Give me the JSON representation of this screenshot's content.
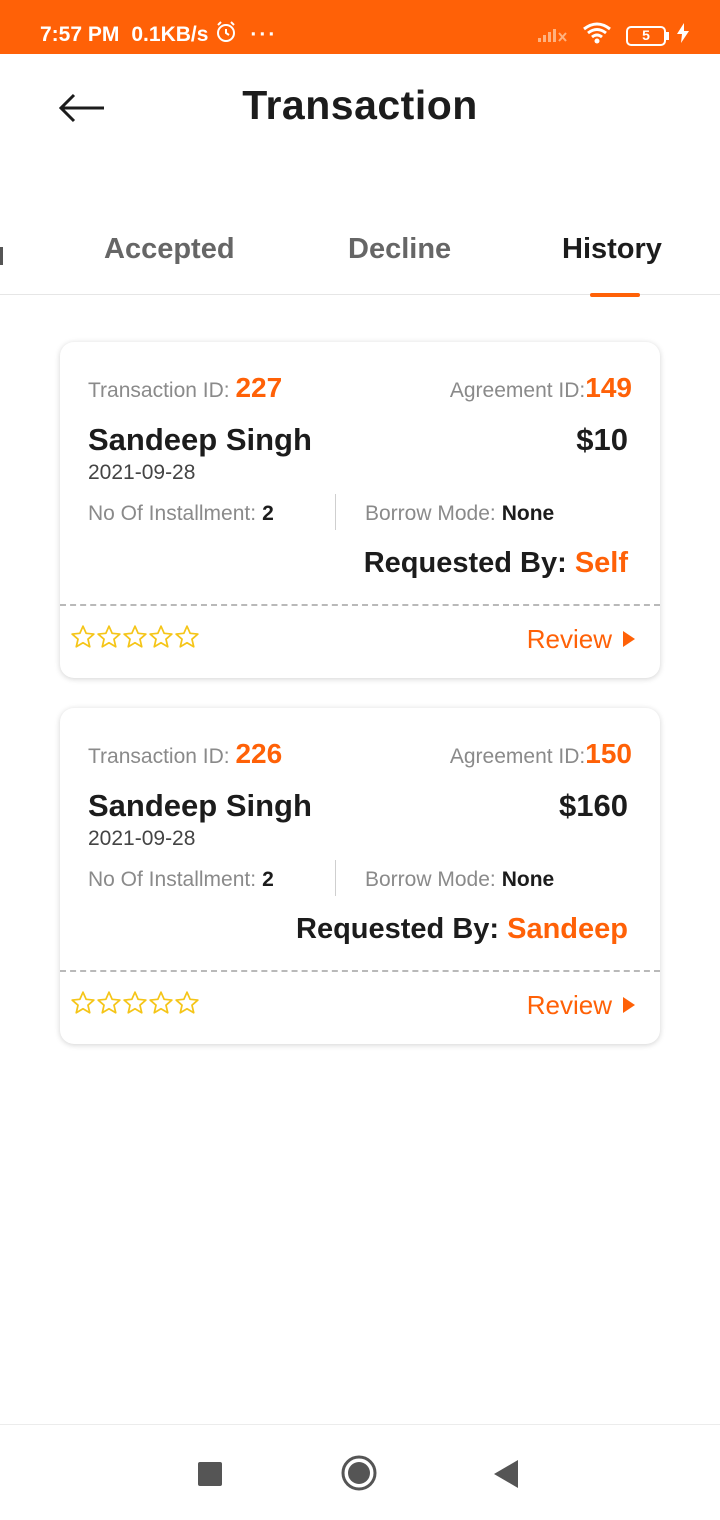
{
  "status_bar": {
    "time": "7:57 PM",
    "speed": "0.1KB/s",
    "more": "···",
    "battery": "5",
    "background": "#ff6107"
  },
  "header": {
    "title": "Transaction",
    "back_icon": "arrow-left-icon"
  },
  "tabs": [
    {
      "label": "Accepted",
      "active": false
    },
    {
      "label": "Decline",
      "active": false
    },
    {
      "label": "History",
      "active": true
    }
  ],
  "accent_color": "#ff6107",
  "transactions": [
    {
      "transaction_id_label": "Transaction ID:",
      "transaction_id": "227",
      "agreement_id_label": "Agreement ID:",
      "agreement_id": "149",
      "name": "Sandeep Singh",
      "amount": "$10",
      "date": "2021-09-28",
      "installment_label": "No Of Installment:",
      "installments": "2",
      "borrow_mode_label": "Borrow Mode:",
      "borrow_mode": "None",
      "requested_by_label": "Requested By:",
      "requested_by": "Self",
      "rating": 0,
      "review_label": "Review"
    },
    {
      "transaction_id_label": "Transaction ID:",
      "transaction_id": "226",
      "agreement_id_label": "Agreement ID:",
      "agreement_id": "150",
      "name": "Sandeep Singh",
      "amount": "$160",
      "date": "2021-09-28",
      "installment_label": "No Of Installment:",
      "installments": "2",
      "borrow_mode_label": "Borrow Mode:",
      "borrow_mode": "None",
      "requested_by_label": "Requested By:",
      "requested_by": "Sandeep",
      "rating": 0,
      "review_label": "Review"
    }
  ],
  "nav_bar": {
    "recents_icon": "square-icon",
    "home_icon": "circle-icon",
    "back_icon": "triangle-back-icon"
  }
}
